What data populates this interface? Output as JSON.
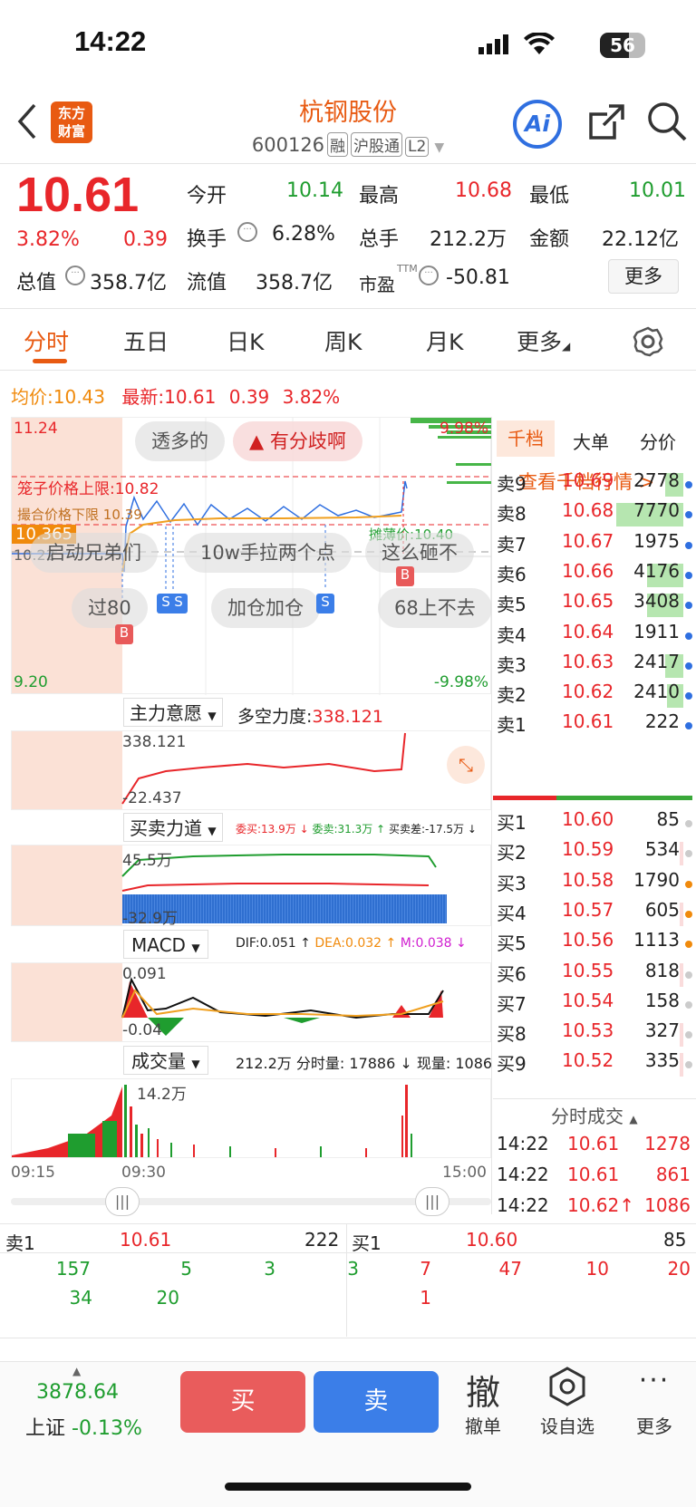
{
  "status": {
    "time": "14:22",
    "battery": "56"
  },
  "header": {
    "back_icon": "chevron-left-icon",
    "logo_top": "东方",
    "logo_bottom": "财富",
    "title": "杭钢股份",
    "code": "600126",
    "tags": [
      "融",
      "沪股通",
      "L2"
    ],
    "ai": "Ai"
  },
  "quote": {
    "price": "10.61",
    "pct": "3.82%",
    "chg": "0.39",
    "open_label": "今开",
    "open": "10.14",
    "high_label": "最高",
    "high": "10.68",
    "low_label": "最低",
    "low": "10.01",
    "turnover_label": "换手",
    "turnover": "6.28%",
    "vol_label": "总手",
    "vol": "212.2万",
    "amount_label": "金额",
    "amount": "22.12亿",
    "mcap_label": "总值",
    "mcap": "358.7亿",
    "float_label": "流值",
    "float": "358.7亿",
    "pe_label": "市盈",
    "pe_sup": "TTM",
    "pe": "-50.81",
    "more": "更多"
  },
  "tabs": [
    "分时",
    "五日",
    "日K",
    "周K",
    "月K",
    "更多"
  ],
  "chart": {
    "avg_label": "均价:",
    "avg": "10.43",
    "last_label": "最新:",
    "last": "10.61",
    "chg": "0.39",
    "pct": "3.82%",
    "y_top": "11.24",
    "y_bot": "9.20",
    "pct_top": "9.98%",
    "pct_bot": "-9.98%",
    "left_price": "10.365",
    "left_mid": "10.22",
    "cage_label": "笼子价格上限:",
    "cage": "10.82",
    "stop_label": "撮合价格下限",
    "stop_price": "10.39",
    "mid_label": "摊薄价:",
    "mid_price": "10.40",
    "bubbles": [
      "透多的",
      "有分歧啊",
      "启动兄弟们",
      "10w手拉两个点",
      "这么砸不",
      "过80",
      "加仓加仓",
      "68上不去"
    ],
    "b_mark": "B",
    "s_mark": "S",
    "ind1_name": "主力意愿",
    "ind1_label": "多空力度:",
    "ind1_val": "338.121",
    "ind1_top": "338.121",
    "ind1_bot": "-22.437",
    "ind2_name": "买卖力道",
    "ind2_a": "委买:13.9万 ↓",
    "ind2_b": "委卖:31.3万 ↑",
    "ind2_c": "买卖差:-17.5万 ↓",
    "ind2_top": "45.5万",
    "ind2_bot": "-32.9万",
    "macd_name": "MACD",
    "dif": "DIF:0.051 ↑",
    "dea": "DEA:0.032 ↑",
    "m": "M:0.038 ↓",
    "macd_top": "0.091",
    "macd_bot": "-0.04",
    "vol_name": "成交量",
    "vol_total": "212.2万",
    "vol_min": "分时量: 17886 ↓",
    "vol_now": "现量: 1086",
    "vol_top": "14.2万",
    "t_start": "09:15",
    "t_open": "09:30",
    "t_end": "15:00"
  },
  "book": {
    "tabs": [
      "千档",
      "大单",
      "分价"
    ],
    "link": "查看千档行情 >",
    "asks": [
      [
        "卖9",
        "10.69",
        "2778"
      ],
      [
        "卖8",
        "10.68",
        "7770"
      ],
      [
        "卖7",
        "10.67",
        "1975"
      ],
      [
        "卖6",
        "10.66",
        "4176"
      ],
      [
        "卖5",
        "10.65",
        "3408"
      ],
      [
        "卖4",
        "10.64",
        "1911"
      ],
      [
        "卖3",
        "10.63",
        "2417"
      ],
      [
        "卖2",
        "10.62",
        "2410"
      ],
      [
        "卖1",
        "10.61",
        "222"
      ]
    ],
    "bids": [
      [
        "买1",
        "10.60",
        "85"
      ],
      [
        "买2",
        "10.59",
        "534"
      ],
      [
        "买3",
        "10.58",
        "1790"
      ],
      [
        "买4",
        "10.57",
        "605"
      ],
      [
        "买5",
        "10.56",
        "1113"
      ],
      [
        "买6",
        "10.55",
        "818"
      ],
      [
        "买7",
        "10.54",
        "158"
      ],
      [
        "买8",
        "10.53",
        "327"
      ],
      [
        "买9",
        "10.52",
        "335"
      ]
    ],
    "trades_title": "分时成交",
    "trades": [
      [
        "14:22",
        "10.61",
        "1278"
      ],
      [
        "14:22",
        "10.61",
        "861"
      ],
      [
        "14:22",
        "10.62↑",
        "1086"
      ]
    ]
  },
  "queue": {
    "sell_label": "卖1",
    "sell_price": "10.61",
    "sell_vol": "222",
    "buy_label": "买1",
    "buy_price": "10.60",
    "buy_vol": "85",
    "sell_q": [
      "157",
      "5",
      "3",
      "3",
      "34",
      "20"
    ],
    "buy_q": [
      "7",
      "47",
      "10",
      "20",
      "1"
    ]
  },
  "bottom": {
    "index": "3878.64",
    "index_name": "上证",
    "index_pct": "-0.13%",
    "buy": "买",
    "sell": "卖",
    "cancel_glyph": "撤",
    "cancel": "撤单",
    "fav": "设自选",
    "more": "更多"
  }
}
